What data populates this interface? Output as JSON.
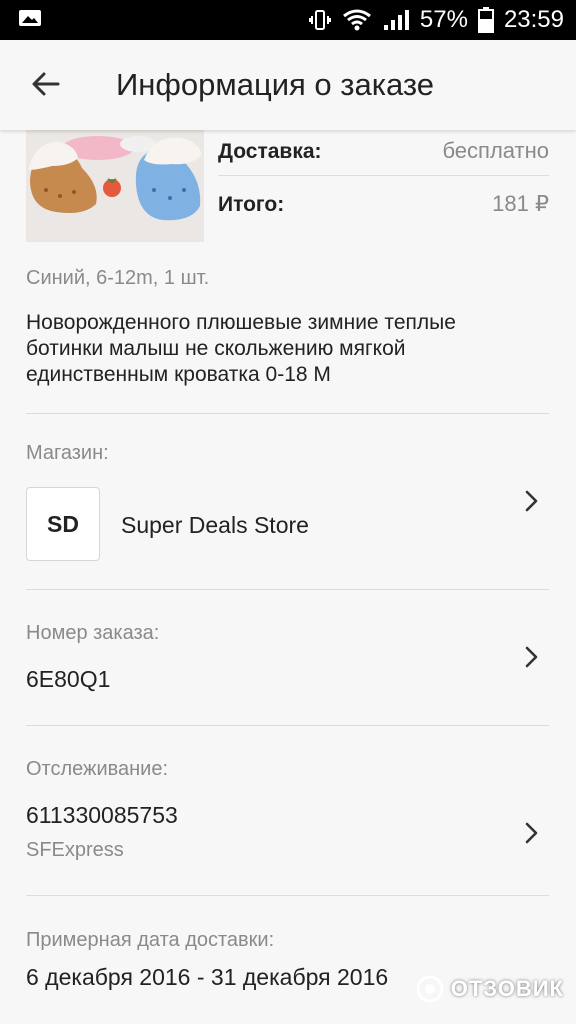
{
  "status_bar": {
    "battery_percent": "57%",
    "time": "23:59"
  },
  "app_bar": {
    "title": "Информация о заказе"
  },
  "order_summary": {
    "delivery_label": "Доставка:",
    "delivery_value": "бесплатно",
    "total_label": "Итого:",
    "total_value": "181 ₽"
  },
  "product": {
    "variant": "Синий, 6-12m, 1 шт.",
    "name": "Новорожденного плюшевые зимние теплые ботинки малыш не скольжению мягкой единственным кроватка 0-18 М"
  },
  "store": {
    "label": "Магазин:",
    "logo_text": "SD",
    "name": "Super Deals Store"
  },
  "order_number": {
    "label": "Номер заказа:",
    "value": "6E80Q1"
  },
  "tracking": {
    "label": "Отслеживание:",
    "number": "611330085753",
    "carrier": "SFExpress"
  },
  "delivery_date": {
    "label": "Примерная дата доставки:",
    "value": "6 декабря 2016 - 31 декабря 2016"
  },
  "watermark": {
    "text": "ОТЗОВИК"
  },
  "icons": [
    "image-icon",
    "vibrate-icon",
    "wifi-icon",
    "signal-icon",
    "battery-icon",
    "back-arrow-icon",
    "chevron-right-icon"
  ]
}
